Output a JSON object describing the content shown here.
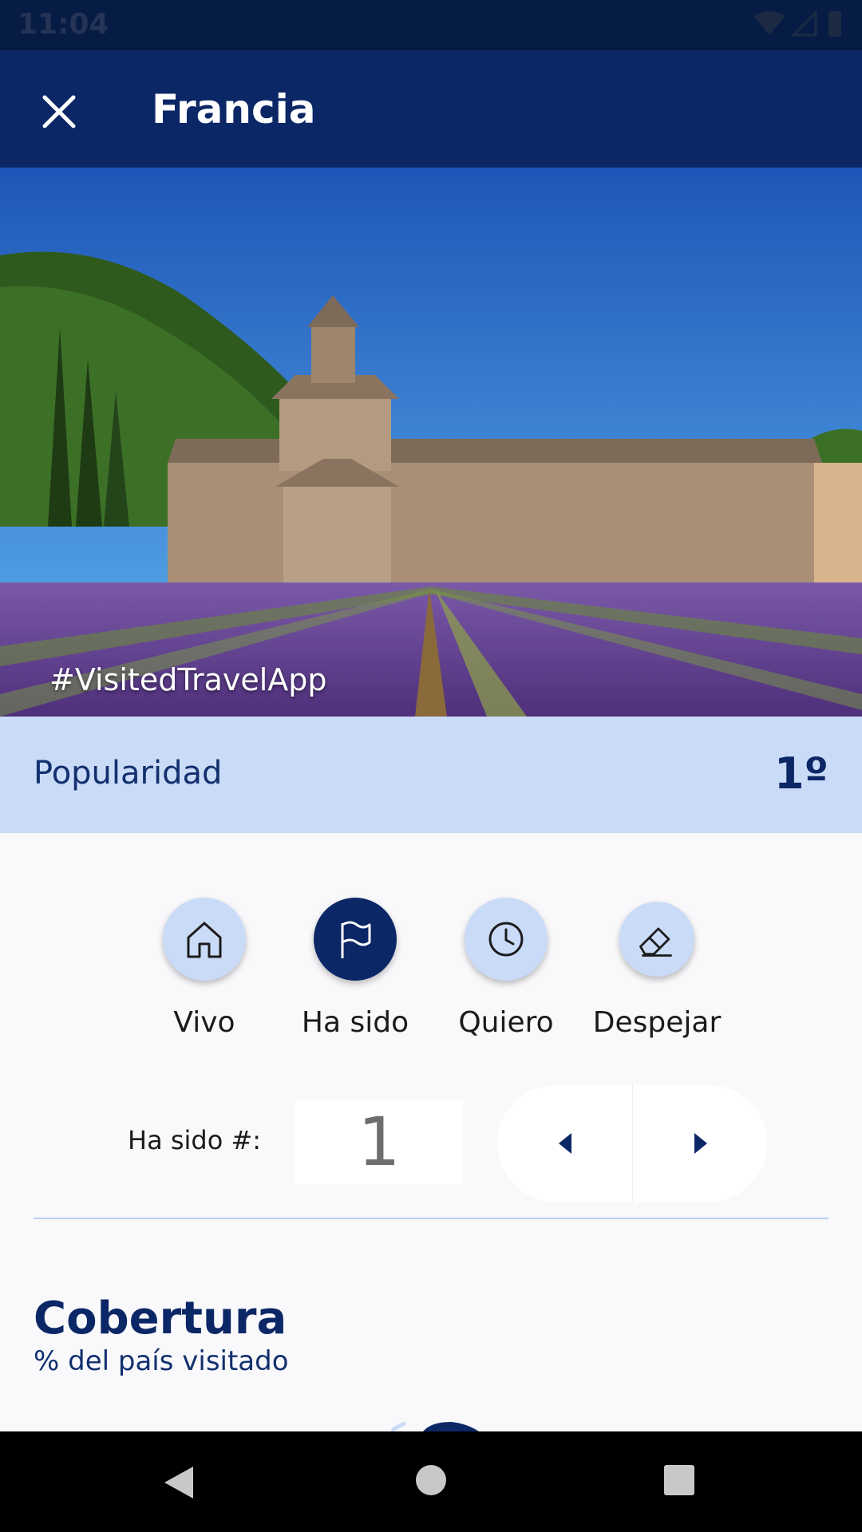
{
  "status_bar": {
    "time": "11:04"
  },
  "app_bar": {
    "title": "Francia"
  },
  "hero": {
    "hashtag": "#VisitedTravelApp"
  },
  "popularity": {
    "label": "Popularidad",
    "value": "1º"
  },
  "status_buttons": [
    {
      "label": "Vivo",
      "icon": "home-icon",
      "selected": false
    },
    {
      "label": "Ha sido",
      "icon": "flag-icon",
      "selected": true
    },
    {
      "label": "Quiero",
      "icon": "clock-icon",
      "selected": false
    },
    {
      "label": "Despejar",
      "icon": "eraser-icon",
      "selected": false
    }
  ],
  "visit_counter": {
    "label": "Ha sido #:",
    "value": "1"
  },
  "coverage": {
    "title": "Cobertura",
    "subtitle": "% del país visitado"
  },
  "colors": {
    "primary": "#0b2766",
    "light": "#cadbf8",
    "background": "#f9f9fb"
  }
}
